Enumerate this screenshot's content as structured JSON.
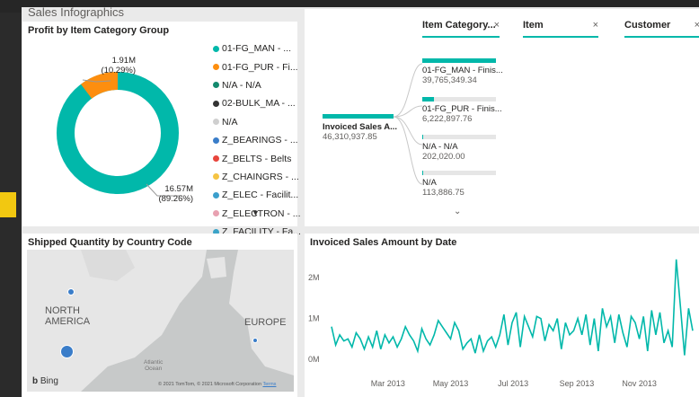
{
  "report": {
    "title": "Sales Infographics"
  },
  "donut": {
    "title": "Profit by Item Category Group",
    "big_value": "16.57M",
    "big_pct": "(89.26%)",
    "small_value": "1.91M",
    "small_pct": "(10.29%)",
    "legend": [
      {
        "label": "01-FG_MAN - ...",
        "color": "#01b8aa"
      },
      {
        "label": "01-FG_PUR - Fi...",
        "color": "#fd8e0f"
      },
      {
        "label": "N/A - N/A",
        "color": "#148a6e"
      },
      {
        "label": "02-BULK_MA - ...",
        "color": "#333333"
      },
      {
        "label": "N/A",
        "color": "#cfcfcf"
      },
      {
        "label": "Z_BEARINGS - ...",
        "color": "#3a7dc9"
      },
      {
        "label": "Z_BELTS - Belts",
        "color": "#e8453c"
      },
      {
        "label": "Z_CHAINGRS - ...",
        "color": "#f5c443"
      },
      {
        "label": "Z_ELEC - Facilit...",
        "color": "#3b9fcc"
      },
      {
        "label": "Z_ELECTRON - ...",
        "color": "#e8a1b1"
      },
      {
        "label": "Z_FACILITY - Fa...",
        "color": "#3ba3c7"
      }
    ],
    "more_icon": "chevron-down-icon"
  },
  "slicers": [
    {
      "label": "Item Category...",
      "close": "×"
    },
    {
      "label": "Item",
      "close": "×"
    },
    {
      "label": "Customer",
      "close": "×"
    }
  ],
  "tree": {
    "root_label": "Invoiced Sales A...",
    "root_value": "46,310,937.85",
    "nodes": [
      {
        "label": "01-FG_MAN - Finis...",
        "value": "39,765,349.34",
        "fraction": 0.8587
      },
      {
        "label": "01-FG_PUR - Finis...",
        "value": "6,222,897.76",
        "fraction": 0.1344
      },
      {
        "label": "N/A - N/A",
        "value": "202,020.00",
        "fraction": 0.0044
      },
      {
        "label": "N/A",
        "value": "113,886.75",
        "fraction": 0.0025
      }
    ],
    "more_icon": "chevron-down-icon"
  },
  "map": {
    "title": "Shipped Quantity by Country Code",
    "labels": {
      "north_america": "NORTH\nAMERICA",
      "europe": "EUROPE",
      "ocean": "Atlantic\nOcean"
    },
    "logo": "Bing",
    "copyright": "© 2021 TomTom, © 2021 Microsoft Corporation",
    "terms": "Terms"
  },
  "chart_data": {
    "type": "line",
    "title": "Invoiced Sales Amount by Date",
    "y_ticks": [
      "2M",
      "1M",
      "0M"
    ],
    "x_ticks": [
      "Mar 2013",
      "May 2013",
      "Jul 2013",
      "Sep 2013",
      "Nov 2013"
    ],
    "ylim": [
      0,
      2600000
    ],
    "color": "#01b8aa",
    "x": [
      "2013-01-05",
      "2013-01-09",
      "2013-01-13",
      "2013-01-17",
      "2013-01-21",
      "2013-01-25",
      "2013-01-29",
      "2013-02-02",
      "2013-02-06",
      "2013-02-10",
      "2013-02-14",
      "2013-02-18",
      "2013-02-22",
      "2013-02-26",
      "2013-03-02",
      "2013-03-06",
      "2013-03-10",
      "2013-03-14",
      "2013-03-18",
      "2013-03-22",
      "2013-03-26",
      "2013-03-30",
      "2013-04-03",
      "2013-04-07",
      "2013-04-11",
      "2013-04-15",
      "2013-04-19",
      "2013-04-23",
      "2013-04-27",
      "2013-05-01",
      "2013-05-05",
      "2013-05-09",
      "2013-05-13",
      "2013-05-17",
      "2013-05-21",
      "2013-05-25",
      "2013-05-29",
      "2013-06-02",
      "2013-06-06",
      "2013-06-10",
      "2013-06-14",
      "2013-06-18",
      "2013-06-22",
      "2013-06-26",
      "2013-06-30",
      "2013-07-04",
      "2013-07-08",
      "2013-07-12",
      "2013-07-16",
      "2013-07-20",
      "2013-07-24",
      "2013-07-28",
      "2013-08-01",
      "2013-08-05",
      "2013-08-09",
      "2013-08-13",
      "2013-08-17",
      "2013-08-21",
      "2013-08-25",
      "2013-08-29",
      "2013-09-02",
      "2013-09-06",
      "2013-09-10",
      "2013-09-14",
      "2013-09-18",
      "2013-09-22",
      "2013-09-26",
      "2013-09-30",
      "2013-10-04",
      "2013-10-08",
      "2013-10-12",
      "2013-10-16",
      "2013-10-20",
      "2013-10-24",
      "2013-10-28",
      "2013-11-01",
      "2013-11-05",
      "2013-11-09",
      "2013-11-13",
      "2013-11-17",
      "2013-11-21",
      "2013-11-25",
      "2013-11-29",
      "2013-12-03",
      "2013-12-07",
      "2013-12-11",
      "2013-12-15",
      "2013-12-19",
      "2013-12-23"
    ],
    "values": [
      800000,
      350000,
      600000,
      450000,
      500000,
      300000,
      650000,
      500000,
      250000,
      550000,
      300000,
      700000,
      250000,
      600000,
      400000,
      550000,
      300000,
      500000,
      800000,
      600000,
      450000,
      200000,
      750000,
      500000,
      350000,
      600000,
      950000,
      800000,
      650000,
      500000,
      900000,
      700000,
      250000,
      400000,
      500000,
      150000,
      600000,
      200000,
      450000,
      550000,
      300000,
      600000,
      1100000,
      350000,
      900000,
      1150000,
      300000,
      1050000,
      800000,
      550000,
      1050000,
      1000000,
      450000,
      850000,
      700000,
      1000000,
      250000,
      900000,
      600000,
      700000,
      1000000,
      600000,
      1100000,
      350000,
      1000000,
      200000,
      1250000,
      800000,
      1050000,
      400000,
      1100000,
      650000,
      300000,
      1050000,
      900000,
      500000,
      1050000,
      200000,
      1200000,
      600000,
      1150000,
      400000,
      700000,
      300000,
      2450000,
      1300000,
      100000,
      1250000,
      700000
    ]
  }
}
